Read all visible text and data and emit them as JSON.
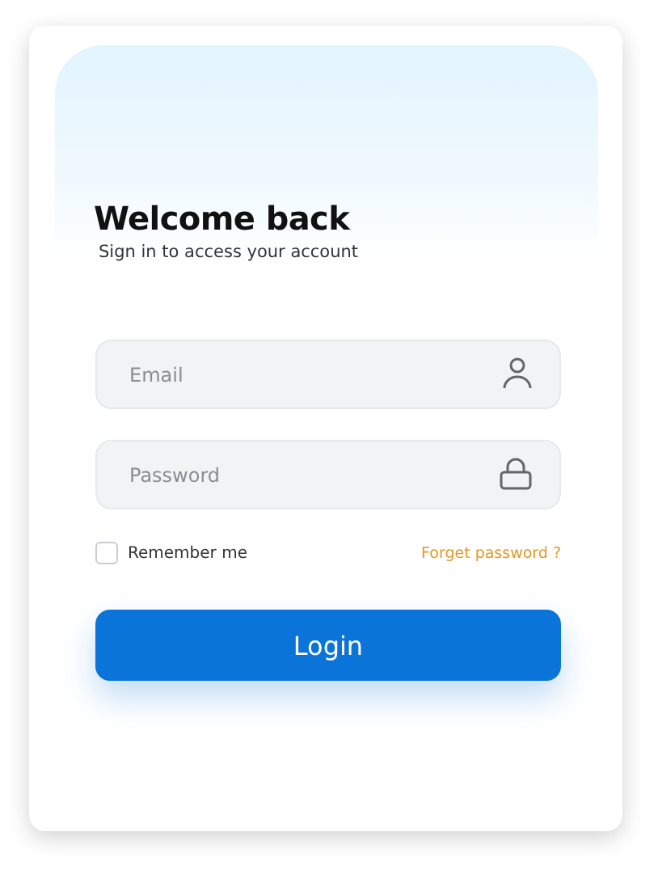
{
  "title": "Welcome back",
  "subtitle": "Sign in to access your account",
  "fields": [
    {
      "kind": "email",
      "placeholder": "Email"
    },
    {
      "kind": "password",
      "placeholder": "Password"
    }
  ],
  "remember": {
    "label": "Remember me",
    "checked": false
  },
  "forgot_link": "Forget password ?",
  "login_button": "Login"
}
